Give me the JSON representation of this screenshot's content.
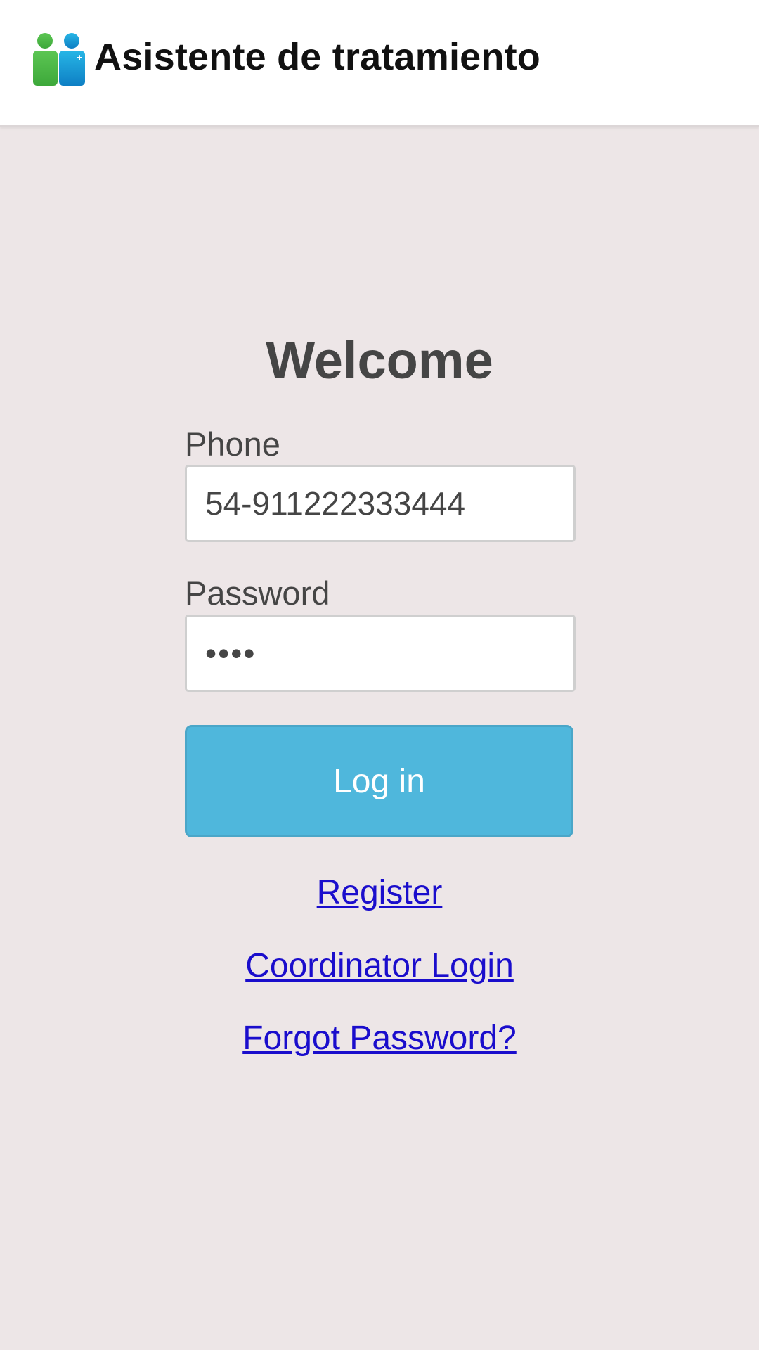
{
  "header": {
    "title": "Asistente de tratamiento",
    "logo_icon": "people-plus-icon",
    "logo_colors": {
      "left_person": "#4cb848",
      "right_person": "#1aa1d8"
    }
  },
  "form": {
    "heading": "Welcome",
    "phone_label": "Phone",
    "phone_value": "54-911222333444",
    "password_label": "Password",
    "password_value": "abcd",
    "login_button_label": "Log in"
  },
  "links": {
    "register": "Register",
    "coordinator_login": "Coordinator Login",
    "forgot_password": "Forgot Password?"
  },
  "colors": {
    "background": "#ede6e7",
    "button": "#4fb7dc",
    "link": "#1a0dcc"
  }
}
